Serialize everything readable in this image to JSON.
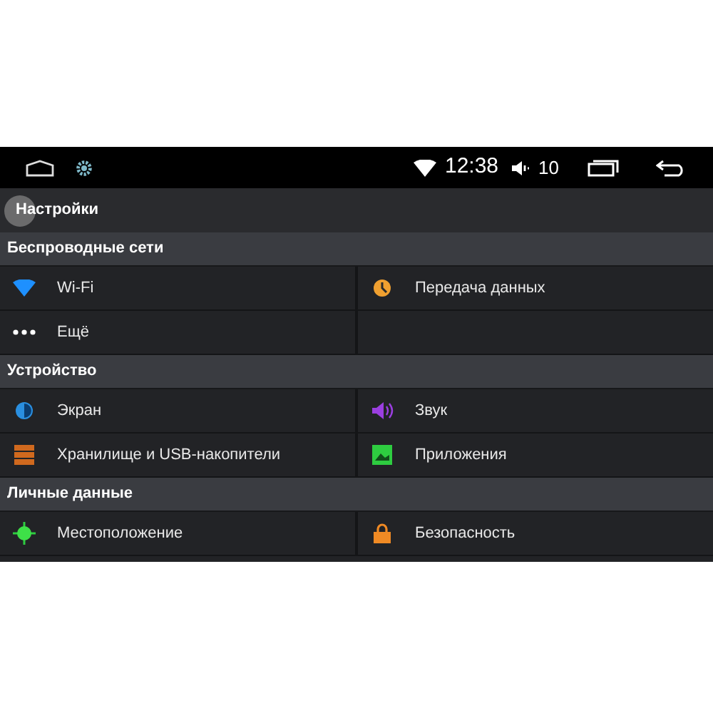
{
  "status_bar": {
    "time": "12:38",
    "volume": "10"
  },
  "title": "Настройки",
  "sections": [
    {
      "header": "Беспроводные сети",
      "rows": [
        [
          {
            "kind": "wifi",
            "label": "Wi-Fi"
          },
          {
            "kind": "data",
            "label": "Передача данных"
          }
        ],
        [
          {
            "kind": "more",
            "label": "Ещё"
          },
          null
        ]
      ]
    },
    {
      "header": "Устройство",
      "rows": [
        [
          {
            "kind": "display",
            "label": "Экран"
          },
          {
            "kind": "sound",
            "label": "Звук"
          }
        ],
        [
          {
            "kind": "storage",
            "label": "Хранилище и USB-накопители"
          },
          {
            "kind": "apps",
            "label": "Приложения"
          }
        ]
      ]
    },
    {
      "header": "Личные данные",
      "rows": [
        [
          {
            "kind": "location",
            "label": "Местоположение"
          },
          {
            "kind": "security",
            "label": "Безопасность"
          }
        ]
      ]
    }
  ]
}
